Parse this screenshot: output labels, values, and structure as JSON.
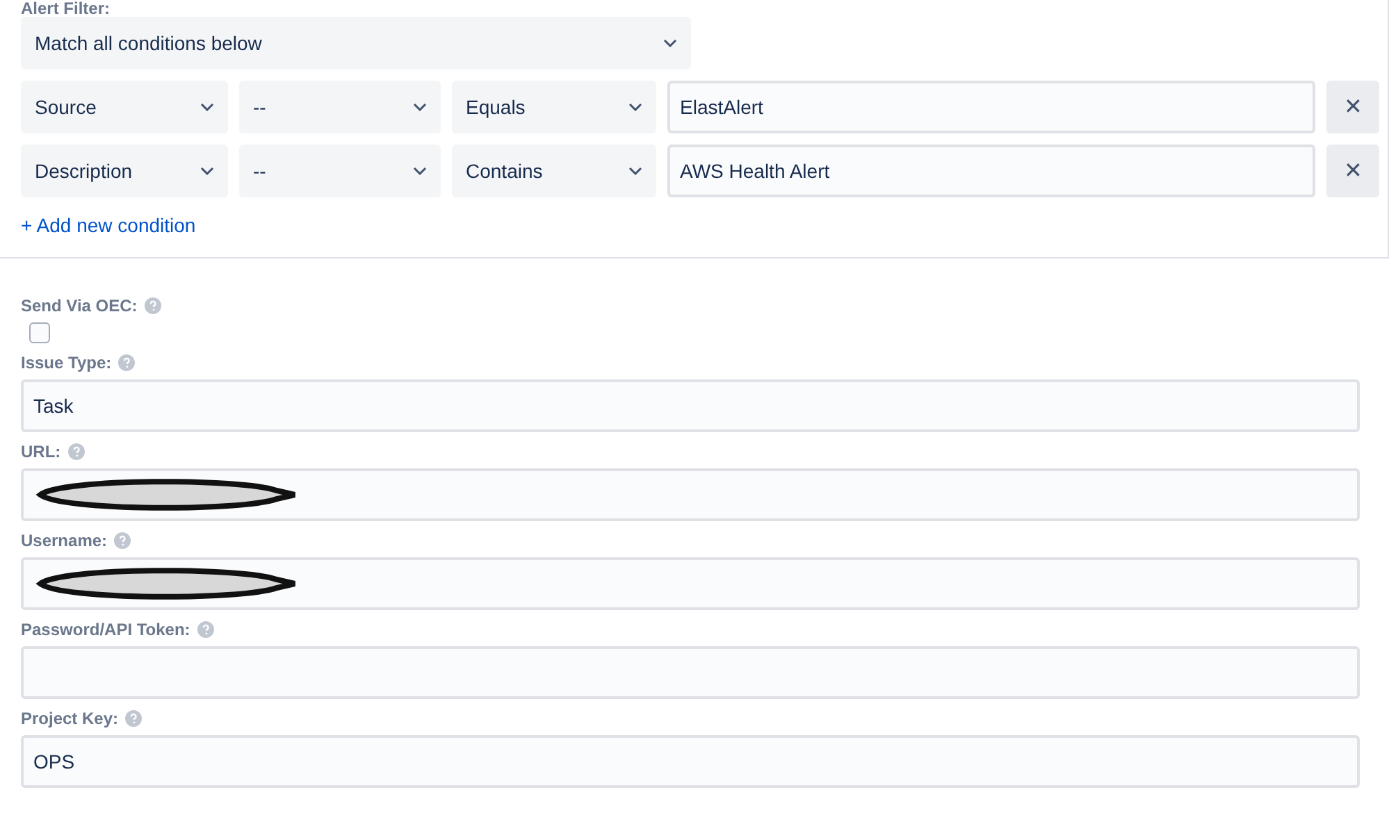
{
  "alert_filter": {
    "label": "Alert Filter:",
    "match": "Match all conditions below",
    "conditions": [
      {
        "field": "Source",
        "sub_field": "--",
        "operation": "Equals",
        "value": "ElastAlert",
        "remove": "✕"
      },
      {
        "field": "Description",
        "sub_field": "--",
        "operation": "Contains",
        "value": "AWS Health Alert",
        "remove": "✕"
      }
    ],
    "add_link": "+ Add new condition"
  },
  "form": {
    "fields": [
      {
        "kind": "checkbox",
        "label": "Send Via OEC:",
        "checked": false
      },
      {
        "kind": "text",
        "label": "Issue Type:",
        "value": "Task",
        "redacted": false
      },
      {
        "kind": "text",
        "label": "URL:",
        "redacted": true
      },
      {
        "kind": "text",
        "label": "Username:",
        "redacted": true
      },
      {
        "kind": "text",
        "label": "Password/API Token:",
        "redacted": false
      },
      {
        "kind": "text",
        "label": "Project Key:",
        "value": "OPS",
        "redacted": false
      }
    ]
  }
}
